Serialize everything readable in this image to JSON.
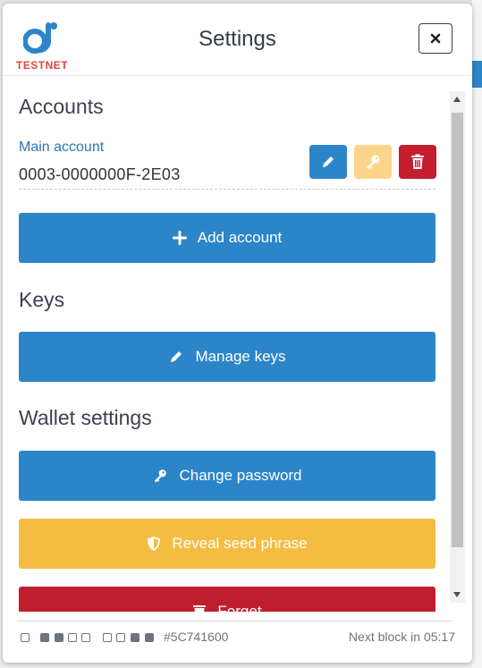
{
  "window": {
    "title": "Settings",
    "logo_label": "TESTNET"
  },
  "accounts": {
    "heading": "Accounts",
    "items": [
      {
        "name": "Main account",
        "id": "0003-0000000F-2E03"
      }
    ],
    "add_label": "Add account"
  },
  "keys": {
    "heading": "Keys",
    "manage_label": "Manage keys"
  },
  "wallet_settings": {
    "heading": "Wallet settings",
    "change_password_label": "Change password",
    "reveal_seed_label": "Reveal seed phrase",
    "forget_label": "Forget"
  },
  "footer": {
    "sync_squares": [
      "empty",
      "filled",
      "filled",
      "empty",
      "empty",
      "empty",
      "empty",
      "filled",
      "filled"
    ],
    "block_hash": "#5C741600",
    "next_block": "Next block in 05:17"
  },
  "colors": {
    "primary": "#2c85c8",
    "warning": "#f5bc42",
    "danger": "#bf1e2e",
    "key_button": "#fcd58a",
    "testnet_label": "#e0463b",
    "account_name": "#2a76b5"
  },
  "icons": {
    "logo": "wallet-logo-icon",
    "close": "close-icon",
    "edit": "pencil-icon",
    "key": "key-icon",
    "delete": "trash-icon",
    "add": "plus-icon",
    "shield": "shield-icon"
  }
}
